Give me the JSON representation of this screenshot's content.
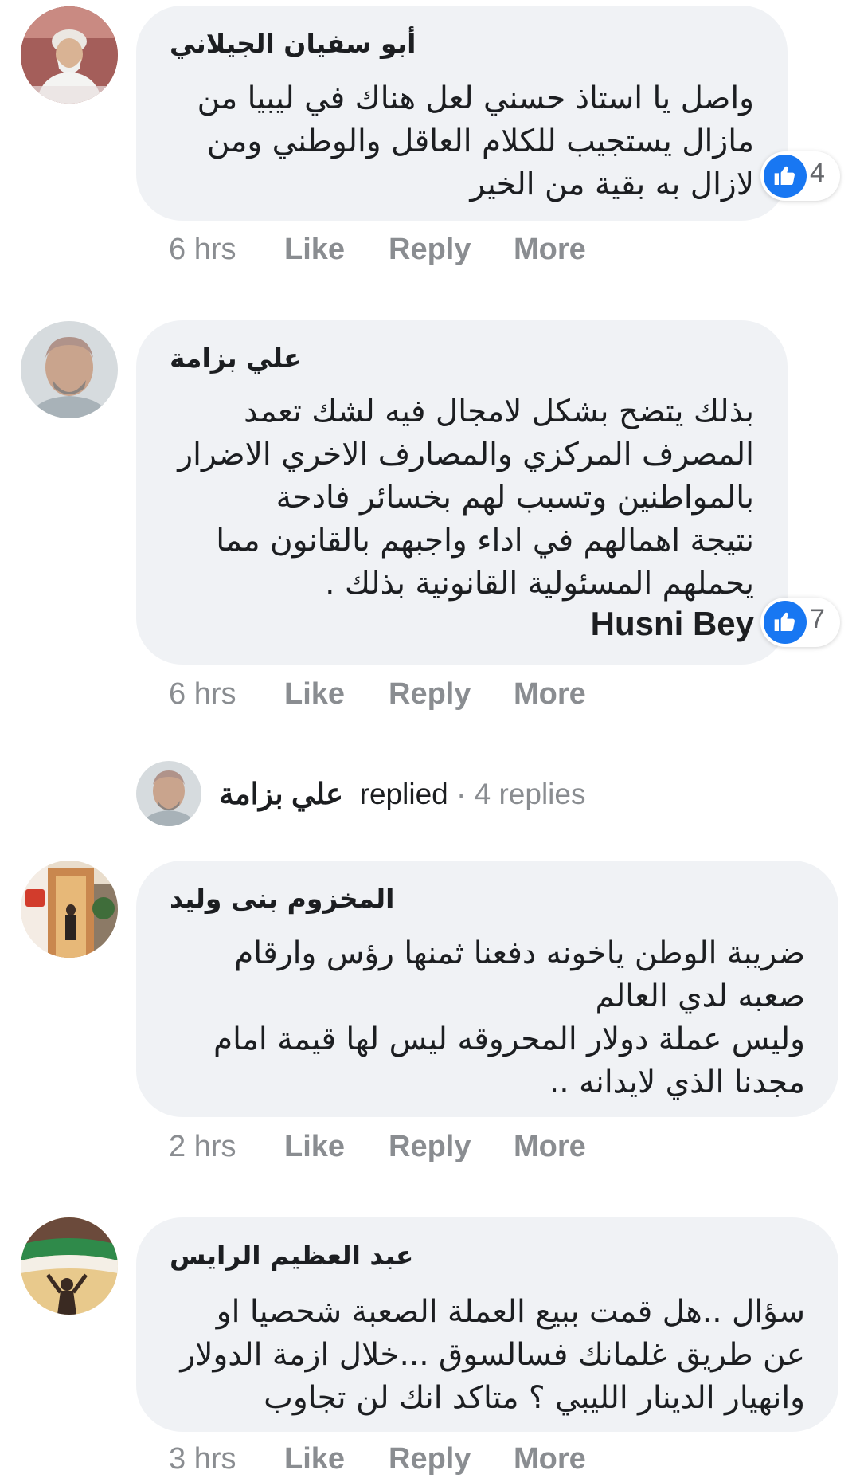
{
  "like_count_color": "#1877f2",
  "comments": [
    {
      "author": "أبو سفيان الجيلاني",
      "text_lines": [
        "واصل يا استاذ حسني لعل هناك في ليبيا من",
        "مازال يستجيب للكلام العاقل والوطني ومن",
        "لازال به بقية من الخير"
      ],
      "tag": "",
      "reaction_icon": "thumbs-up-icon",
      "reaction_count": "4",
      "time": "6 hrs",
      "like_label": "Like",
      "reply_label": "Reply",
      "more_label": "More"
    },
    {
      "author": "علي بزامة",
      "text_lines": [
        "بذلك يتضح بشكل لامجال فيه لشك تعمد",
        "المصرف المركزي والمصارف الاخري الاضرار",
        "بالمواطنين وتسبب لهم بخسائر فادحة",
        "نتيجة اهمالهم في اداء واجبهم بالقانون مما",
        "يحملهم المسئولية القانونية بذلك ."
      ],
      "tag": "Husni Bey",
      "reaction_icon": "thumbs-up-icon",
      "reaction_count": "7",
      "time": "6 hrs",
      "like_label": "Like",
      "reply_label": "Reply",
      "more_label": "More"
    },
    {
      "author": "المخزوم بنى وليد",
      "text_lines": [
        "ضريبة الوطن ياخونه دفعنا ثمنها رؤس وارقام",
        "صعبه لدي العالم",
        "وليس عملة دولار المحروقه ليس لها قيمة امام",
        "مجدنا الذي لايدانه .."
      ],
      "tag": "",
      "time": "2 hrs",
      "like_label": "Like",
      "reply_label": "Reply",
      "more_label": "More"
    },
    {
      "author": "عبد العظيم الرايس",
      "text_lines": [
        "سؤال ..هل قمت ببيع العملة الصعبة شحصيا او",
        "عن طريق غلمانك فسالسوق ...خلال ازمة الدولار",
        "وانهيار الدينار الليبي ؟ متاكد انك لن تجاوب"
      ],
      "tag": "",
      "time": "3 hrs",
      "like_label": "Like",
      "reply_label": "Reply",
      "more_label": "More"
    }
  ],
  "replies_summary": {
    "name": "علي بزامة",
    "replied": "replied",
    "separator": " · ",
    "count": "4 replies"
  }
}
